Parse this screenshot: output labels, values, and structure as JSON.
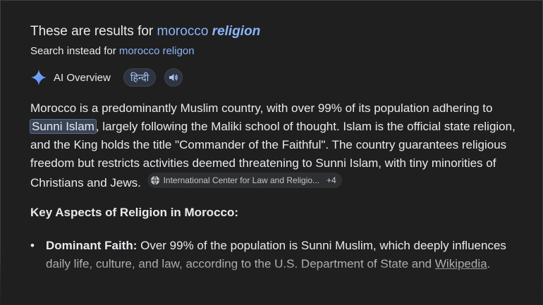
{
  "correction": {
    "prefix": "These are results for ",
    "query_plain": "morocco",
    "query_corrected": "religion",
    "instead_prefix": "Search instead for ",
    "instead_query": "morocco religon"
  },
  "aio": {
    "label": "AI Overview",
    "language_chip": "हिन्दी",
    "sparkle_icon": "sparkle-icon",
    "speaker_icon": "speaker-icon"
  },
  "paragraph": {
    "text_1": "Morocco is a predominantly Muslim country, with over 99% of its population adhering to ",
    "highlight": "Sunni Islam",
    "text_2": ", largely following the Maliki school of thought. Islam is the official state religion, and the King holds the title \"Commander of the Faithful\". The country guarantees religious freedom but restricts activities deemed threatening to Sunni Islam, with tiny minorities of Christians and Jews. ",
    "source_label": "International Center for Law and Religio...",
    "source_more": "+4"
  },
  "section": {
    "heading": "Key Aspects of Religion in Morocco:"
  },
  "bullets": [
    {
      "title": "Dominant Faith:",
      "text": " Over 99% of the population is Sunni Muslim, which deeply influences daily life, culture, and law, according to the U.S. Department of State and ",
      "link": "Wikipedia",
      "end": "."
    }
  ],
  "colors": {
    "background": "#1f1f1f",
    "link": "#8ab4f8",
    "highlight": "#394457"
  }
}
